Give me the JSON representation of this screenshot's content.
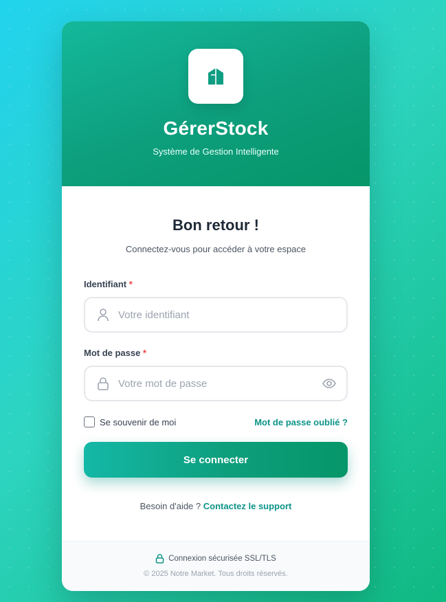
{
  "brand": {
    "name": "GérerStock",
    "tagline": "Système de Gestion Intelligente",
    "logo_icon": "box-icon"
  },
  "login": {
    "title": "Bon retour !",
    "subtitle": "Connectez-vous pour accéder à votre espace",
    "username": {
      "label": "Identifiant",
      "required_mark": "*",
      "placeholder": "Votre identifiant",
      "value": "",
      "icon": "user-icon"
    },
    "password": {
      "label": "Mot de passe",
      "required_mark": "*",
      "placeholder": "Votre mot de passe",
      "value": "",
      "icon": "lock-icon",
      "toggle_icon": "eye-icon"
    },
    "remember_label": "Se souvenir de moi",
    "remember_checked": false,
    "forgot_label": "Mot de passe oublié ?",
    "submit_label": "Se connecter",
    "help_text": "Besoin d'aide ?",
    "help_link": "Contactez le support"
  },
  "footer": {
    "secure_text": "Connexion sécurisée SSL/TLS",
    "copyright": "© 2025 Notre Market. Tous droits réservés."
  },
  "colors": {
    "accent": "#0d9488",
    "header_gradient_start": "#14b89c",
    "header_gradient_end": "#059669",
    "background_start": "#22d3ee",
    "background_end": "#10b981",
    "required": "#ef4444"
  }
}
